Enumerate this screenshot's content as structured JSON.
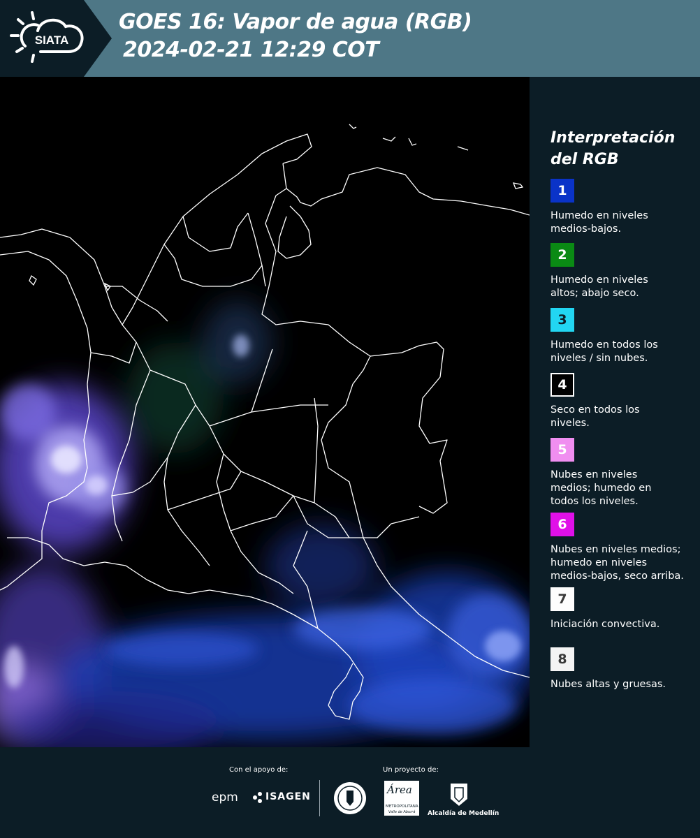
{
  "header": {
    "logo_text": "SIATA",
    "title": "GOES 16: Vapor de agua (RGB)",
    "timestamp": "2024-02-21 12:29 COT"
  },
  "legend": {
    "title_line1": "Interpretación",
    "title_line2": "del RGB",
    "items": [
      {
        "number": "1",
        "color": "#0a33c8",
        "text_color": "#ffffff",
        "line1": "Humedo en niveles",
        "line2": "medios-bajos.",
        "line3": ""
      },
      {
        "number": "2",
        "color": "#0a8a14",
        "text_color": "#ffffff",
        "line1": "Humedo en niveles",
        "line2": "altos; abajo seco.",
        "line3": ""
      },
      {
        "number": "3",
        "color": "#22d6f2",
        "text_color": "#0c1d26",
        "line1": "Humedo en todos los",
        "line2": "niveles / sin nubes.",
        "line3": ""
      },
      {
        "number": "4",
        "color": "#000000",
        "text_color": "#ffffff",
        "line1": "Seco en todos los",
        "line2": "niveles.",
        "line3": ""
      },
      {
        "number": "5",
        "color": "#f08ef0",
        "text_color": "#ffffff",
        "line1": "Nubes en niveles",
        "line2": "medios; humedo en",
        "line3": "todos los niveles."
      },
      {
        "number": "6",
        "color": "#e010e8",
        "text_color": "#ffffff",
        "line1": "Nubes en niveles medios;",
        "line2": "humedo en niveles",
        "line3": "medios-bajos, seco arriba."
      },
      {
        "number": "7",
        "color": "#fdfdfd",
        "text_color": "#3a3a3a",
        "line1": "Iniciación convectiva.",
        "line2": "",
        "line3": ""
      },
      {
        "number": "8",
        "color": "#f4f4f4",
        "text_color": "#3a3a3a",
        "line1": "Nubes altas y gruesas.",
        "line2": "",
        "line3": ""
      }
    ]
  },
  "footer": {
    "support_label": "Con el apoyo de:",
    "project_label": "Un proyecto de:",
    "sponsor1": "epm",
    "sponsor2": "ISAGEN",
    "partner1_caption": "METROPOLITANA",
    "partner1_sub": "Valle de Aburrá",
    "partner1_logo": "Área",
    "partner2": "Alcaldía de Medellín"
  }
}
